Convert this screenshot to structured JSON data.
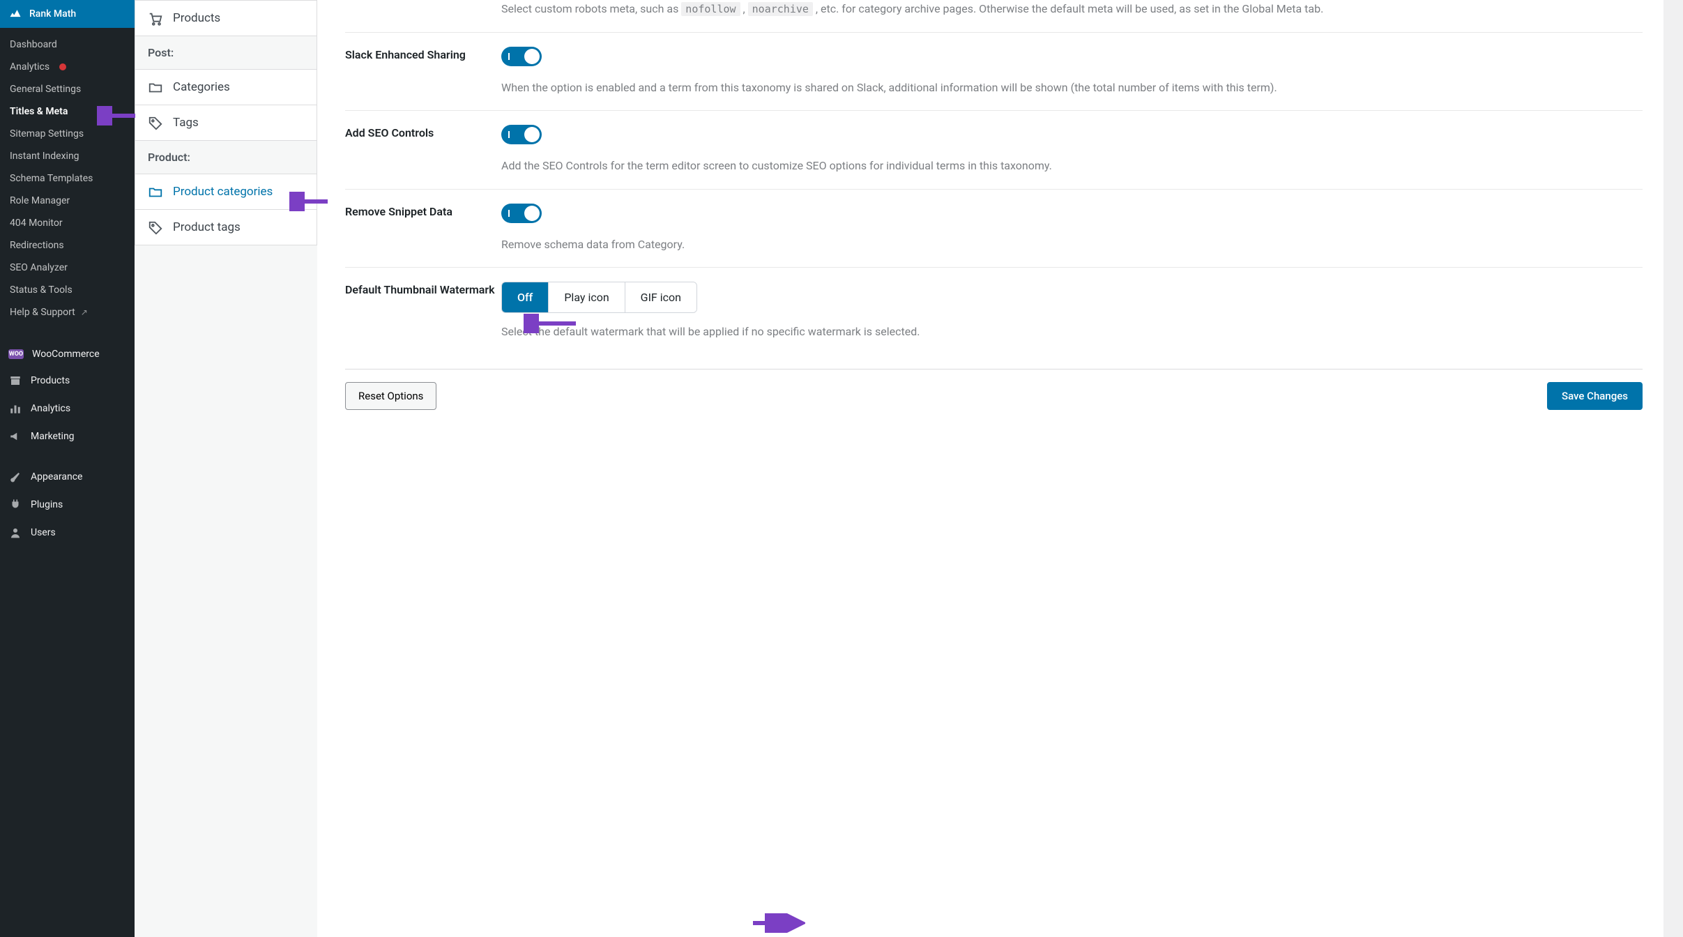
{
  "wp_menu": {
    "active": "Rank Math",
    "submenu": [
      {
        "label": "Dashboard"
      },
      {
        "label": "Analytics",
        "dot": true
      },
      {
        "label": "General Settings"
      },
      {
        "label": "Titles & Meta",
        "active": true
      },
      {
        "label": "Sitemap Settings"
      },
      {
        "label": "Instant Indexing"
      },
      {
        "label": "Schema Templates"
      },
      {
        "label": "Role Manager"
      },
      {
        "label": "404 Monitor"
      },
      {
        "label": "Redirections"
      },
      {
        "label": "SEO Analyzer"
      },
      {
        "label": "Status & Tools"
      },
      {
        "label": "Help & Support",
        "ext": true
      }
    ],
    "top_items": [
      {
        "label": "WooCommerce",
        "icon": "woo"
      },
      {
        "label": "Products",
        "icon": "archive"
      },
      {
        "label": "Analytics",
        "icon": "bar-chart"
      },
      {
        "label": "Marketing",
        "icon": "megaphone"
      }
    ],
    "bottom_items": [
      {
        "label": "Appearance",
        "icon": "brush"
      },
      {
        "label": "Plugins",
        "icon": "plug"
      },
      {
        "label": "Users",
        "icon": "user"
      }
    ]
  },
  "subnav": {
    "items1": [
      {
        "label": "Products"
      }
    ],
    "header1": "Post:",
    "items2": [
      {
        "label": "Categories"
      },
      {
        "label": "Tags"
      }
    ],
    "header2": "Product:",
    "items3": [
      {
        "label": "Product categories",
        "active": true
      },
      {
        "label": "Product tags"
      }
    ]
  },
  "settings": {
    "robots": {
      "label": "",
      "desc_pre": "Select custom robots meta, such as ",
      "chip1": "nofollow",
      "desc_mid": " , ",
      "chip2": "noarchive",
      "desc_post": " , etc. for category archive pages. Otherwise the default meta will be used, as set in the Global Meta tab."
    },
    "slack": {
      "label": "Slack Enhanced Sharing",
      "desc": "When the option is enabled and a term from this taxonomy is shared on Slack, additional information will be shown (the total number of items with this term)."
    },
    "seo_controls": {
      "label": "Add SEO Controls",
      "desc": "Add the SEO Controls for the term editor screen to customize SEO options for individual terms in this taxonomy."
    },
    "remove_snippet": {
      "label": "Remove Snippet Data",
      "desc": "Remove schema data from Category."
    },
    "watermark": {
      "label": "Default Thumbnail Watermark",
      "options": [
        "Off",
        "Play icon",
        "GIF icon"
      ],
      "desc": "Select the default watermark that will be applied if no specific watermark is selected."
    }
  },
  "footer": {
    "reset": "Reset Options",
    "save": "Save Changes"
  }
}
